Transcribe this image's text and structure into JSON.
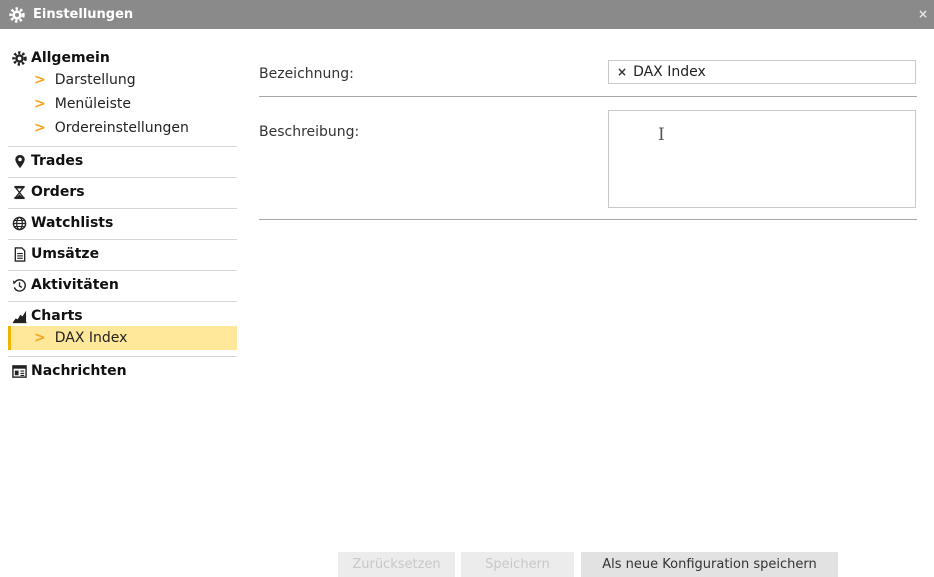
{
  "window": {
    "title": "Einstellungen",
    "close_glyph": "×",
    "icons": {
      "title": "gear-icon",
      "close": "close-icon"
    }
  },
  "sidebar": {
    "sections": [
      {
        "label": "Allgemein",
        "icon": "gear-icon",
        "items": [
          "Darstellung",
          "Menüleiste",
          "Ordereinstellungen"
        ]
      },
      {
        "label": "Trades",
        "icon": "map-pin-icon",
        "items": []
      },
      {
        "label": "Orders",
        "icon": "hourglass-icon",
        "items": []
      },
      {
        "label": "Watchlists",
        "icon": "globe-icon",
        "items": []
      },
      {
        "label": "Umsätze",
        "icon": "document-icon",
        "items": []
      },
      {
        "label": "Aktivitäten",
        "icon": "history-icon",
        "items": []
      },
      {
        "label": "Charts",
        "icon": "area-chart-icon",
        "items": [
          "DAX Index"
        ],
        "active_item": "DAX Index"
      },
      {
        "label": "Nachrichten",
        "icon": "newspaper-icon",
        "items": []
      }
    ],
    "arrow_glyph": ">",
    "accent_color": "#f4a41c",
    "active_background": "#ffe89a"
  },
  "form": {
    "name_label": "Bezeichnung:",
    "name_value": "DAX Index",
    "name_clear_glyph": "×",
    "description_label": "Beschreibung:",
    "description_value": "",
    "cursor_icon": "text-cursor-icon"
  },
  "buttons": {
    "reset": "Zurücksetzen",
    "save": "Speichern",
    "save_new": "Als neue Konfiguration speichern"
  }
}
